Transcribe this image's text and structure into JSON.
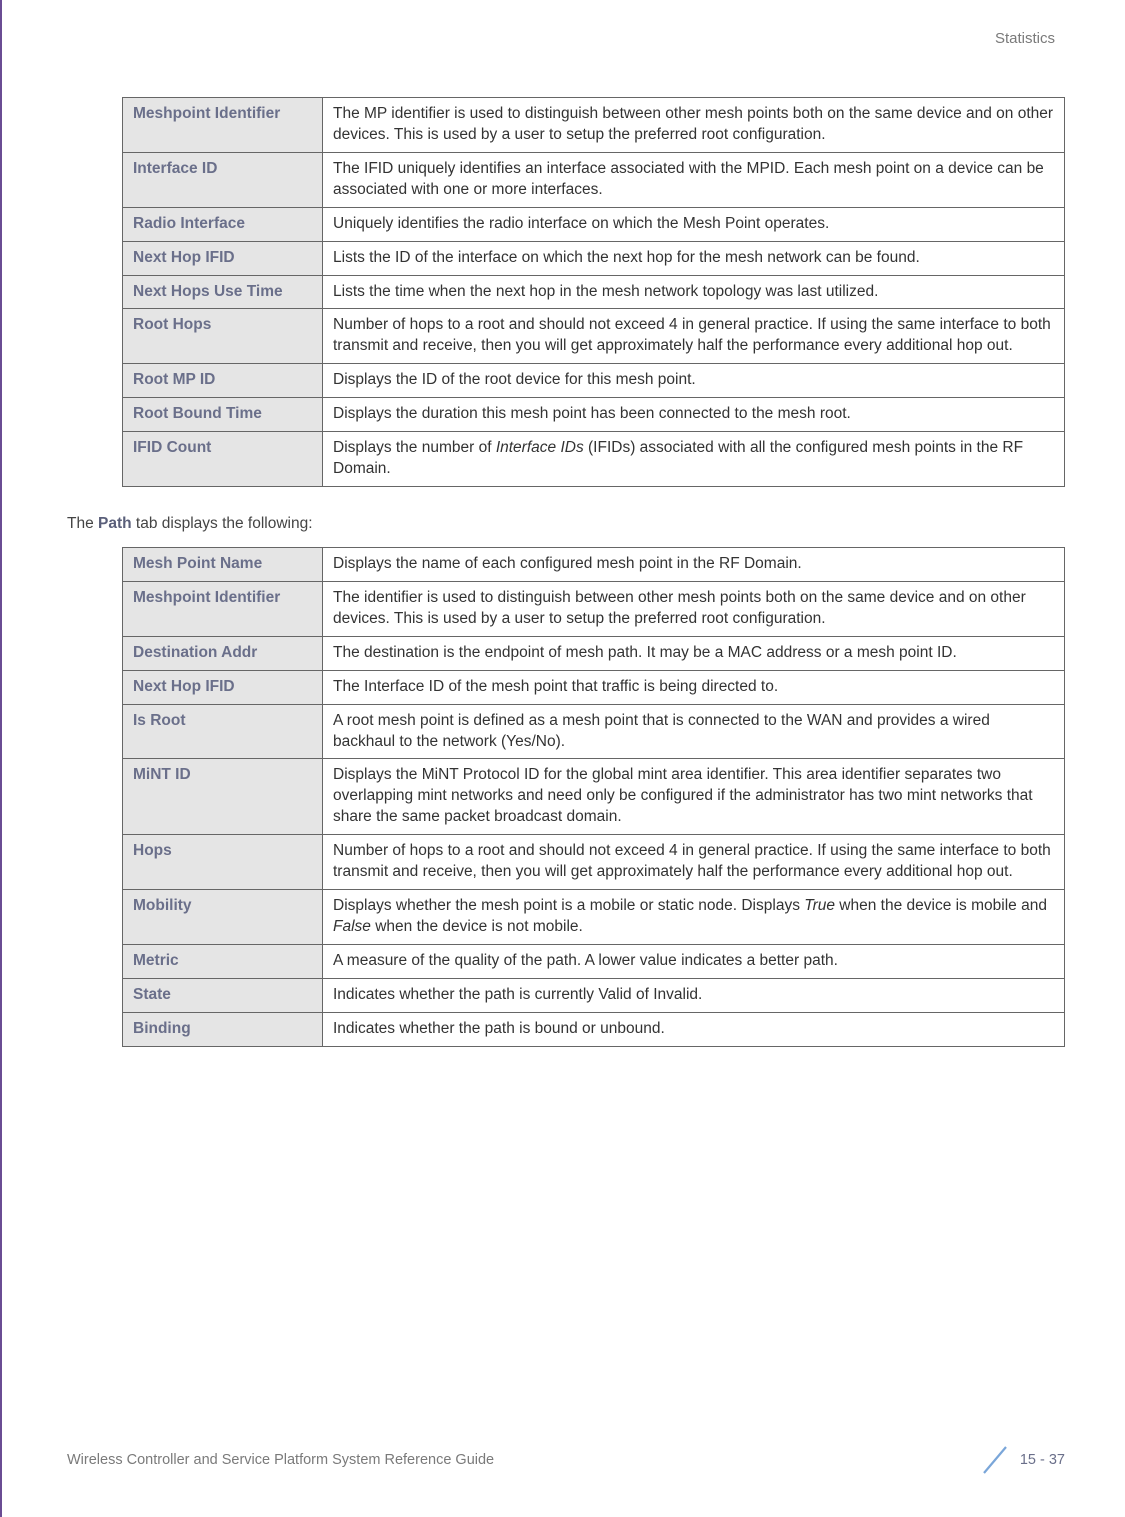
{
  "header": {
    "section": "Statistics"
  },
  "table1": {
    "rows": [
      {
        "label": "Meshpoint Identifier",
        "desc": "The MP identifier is used to distinguish between other mesh points both on the same device and on other devices. This is used by a user to setup the preferred root configuration."
      },
      {
        "label": "Interface ID",
        "desc": "The IFID uniquely identifies an interface associated with the MPID. Each mesh point on a device can be associated with one or more interfaces."
      },
      {
        "label": "Radio Interface",
        "desc": "Uniquely identifies the radio interface on which the Mesh Point operates."
      },
      {
        "label": "Next Hop IFID",
        "desc": "Lists the ID of the interface on which the next hop for the mesh network can be found."
      },
      {
        "label": "Next Hops Use Time",
        "desc": "Lists the time when the next hop in the mesh network topology was last utilized."
      },
      {
        "label": "Root Hops",
        "desc": "Number of hops to a root and should not exceed 4 in general practice. If using the same interface to both transmit and receive, then you will get approximately half the performance every additional hop out."
      },
      {
        "label": "Root MP ID",
        "desc": "Displays the ID of the root device for this mesh point."
      },
      {
        "label": "Root Bound Time",
        "desc": "Displays the duration this mesh point has been connected to the mesh root."
      },
      {
        "label": "IFID Count",
        "desc_pre": "Displays the number of ",
        "desc_it": "Interface IDs",
        "desc_post": " (IFIDs) associated with all the configured mesh points in the RF Domain."
      }
    ]
  },
  "paragraph": {
    "pre": "The ",
    "bold": "Path",
    "post": " tab displays the following:"
  },
  "table2": {
    "rows": [
      {
        "label": "Mesh Point Name",
        "desc": "Displays the name of each configured mesh point in the RF Domain."
      },
      {
        "label": "Meshpoint Identifier",
        "desc": "The identifier is used to distinguish between other mesh points both on the same device and on other devices. This is used by a user to setup the preferred root configuration."
      },
      {
        "label": "Destination Addr",
        "desc": "The destination is the endpoint of mesh path. It may be a MAC address or a mesh point ID."
      },
      {
        "label": "Next Hop IFID",
        "desc": "The Interface ID of the mesh point that traffic is being directed to."
      },
      {
        "label": "Is Root",
        "desc": "A root mesh point is defined as a mesh point that is connected to the WAN and provides a wired backhaul to the network (Yes/No)."
      },
      {
        "label": "MiNT ID",
        "desc": "Displays the MiNT Protocol ID for the global mint area identifier. This area identifier separates two overlapping mint networks and need only be configured if the administrator has two mint networks that share the same packet broadcast domain."
      },
      {
        "label": "Hops",
        "desc": "Number of hops to a root and should not exceed 4 in general practice. If using the same interface to both transmit and receive, then you will get approximately half the performance every additional hop out."
      },
      {
        "label": "Mobility",
        "desc_pre": "Displays whether the mesh point is a mobile or static node. Displays ",
        "desc_it1": "True",
        "desc_mid": " when the device is mobile and ",
        "desc_it2": "False",
        "desc_post": " when the device is not mobile."
      },
      {
        "label": "Metric",
        "desc": "A measure of the quality of the path. A lower value indicates a better path."
      },
      {
        "label": "State",
        "desc": "Indicates whether the path is currently Valid of Invalid."
      },
      {
        "label": "Binding",
        "desc": "Indicates whether the path is bound or unbound."
      }
    ]
  },
  "footer": {
    "left": "Wireless Controller and Service Platform System Reference Guide",
    "page": "15 - 37"
  }
}
